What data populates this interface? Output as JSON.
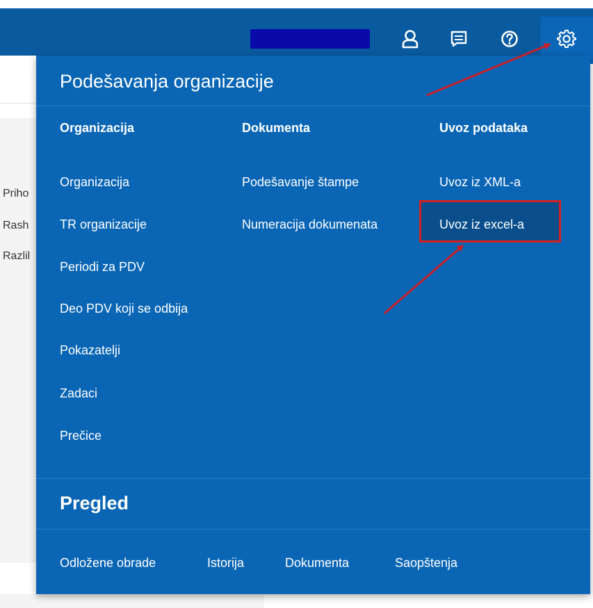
{
  "background": {
    "truncated_rows": [
      "Priho",
      "Rash",
      "Razlil"
    ]
  },
  "header": {
    "icons": [
      "user-icon",
      "messages-icon",
      "help-icon",
      "settings-gear-icon"
    ],
    "colors": {
      "bar": "#0a5aa0",
      "active": "#0b66b8",
      "redaction": "#0a0aa8"
    }
  },
  "panel": {
    "title": "Podešavanja organizacije",
    "columns": [
      {
        "heading": "Organizacija",
        "items": [
          "Organizacija",
          "TR organizacije",
          "Periodi za PDV",
          "Deo PDV koji se odbija",
          "Pokazatelji",
          "Zadaci",
          "Prečice"
        ]
      },
      {
        "heading": "Dokumenta",
        "items": [
          "Podešavanje štampe",
          "Numeracija dokumenata"
        ]
      },
      {
        "heading": "Uvoz podataka",
        "items": [
          "Uvoz iz XML-a",
          "Uvoz iz excel-a"
        ]
      }
    ],
    "highlighted_item": "Uvoz iz excel-a",
    "section2_title": "Pregled",
    "footer_links": [
      "Odložene obrade",
      "Istorija",
      "Dokumenta",
      "Saopštenja"
    ],
    "colors": {
      "panel": "#0a66b5",
      "separator": "#2a7dc6",
      "highlight_border": "#d42020",
      "annotation_arrow": "#c8202a"
    }
  }
}
